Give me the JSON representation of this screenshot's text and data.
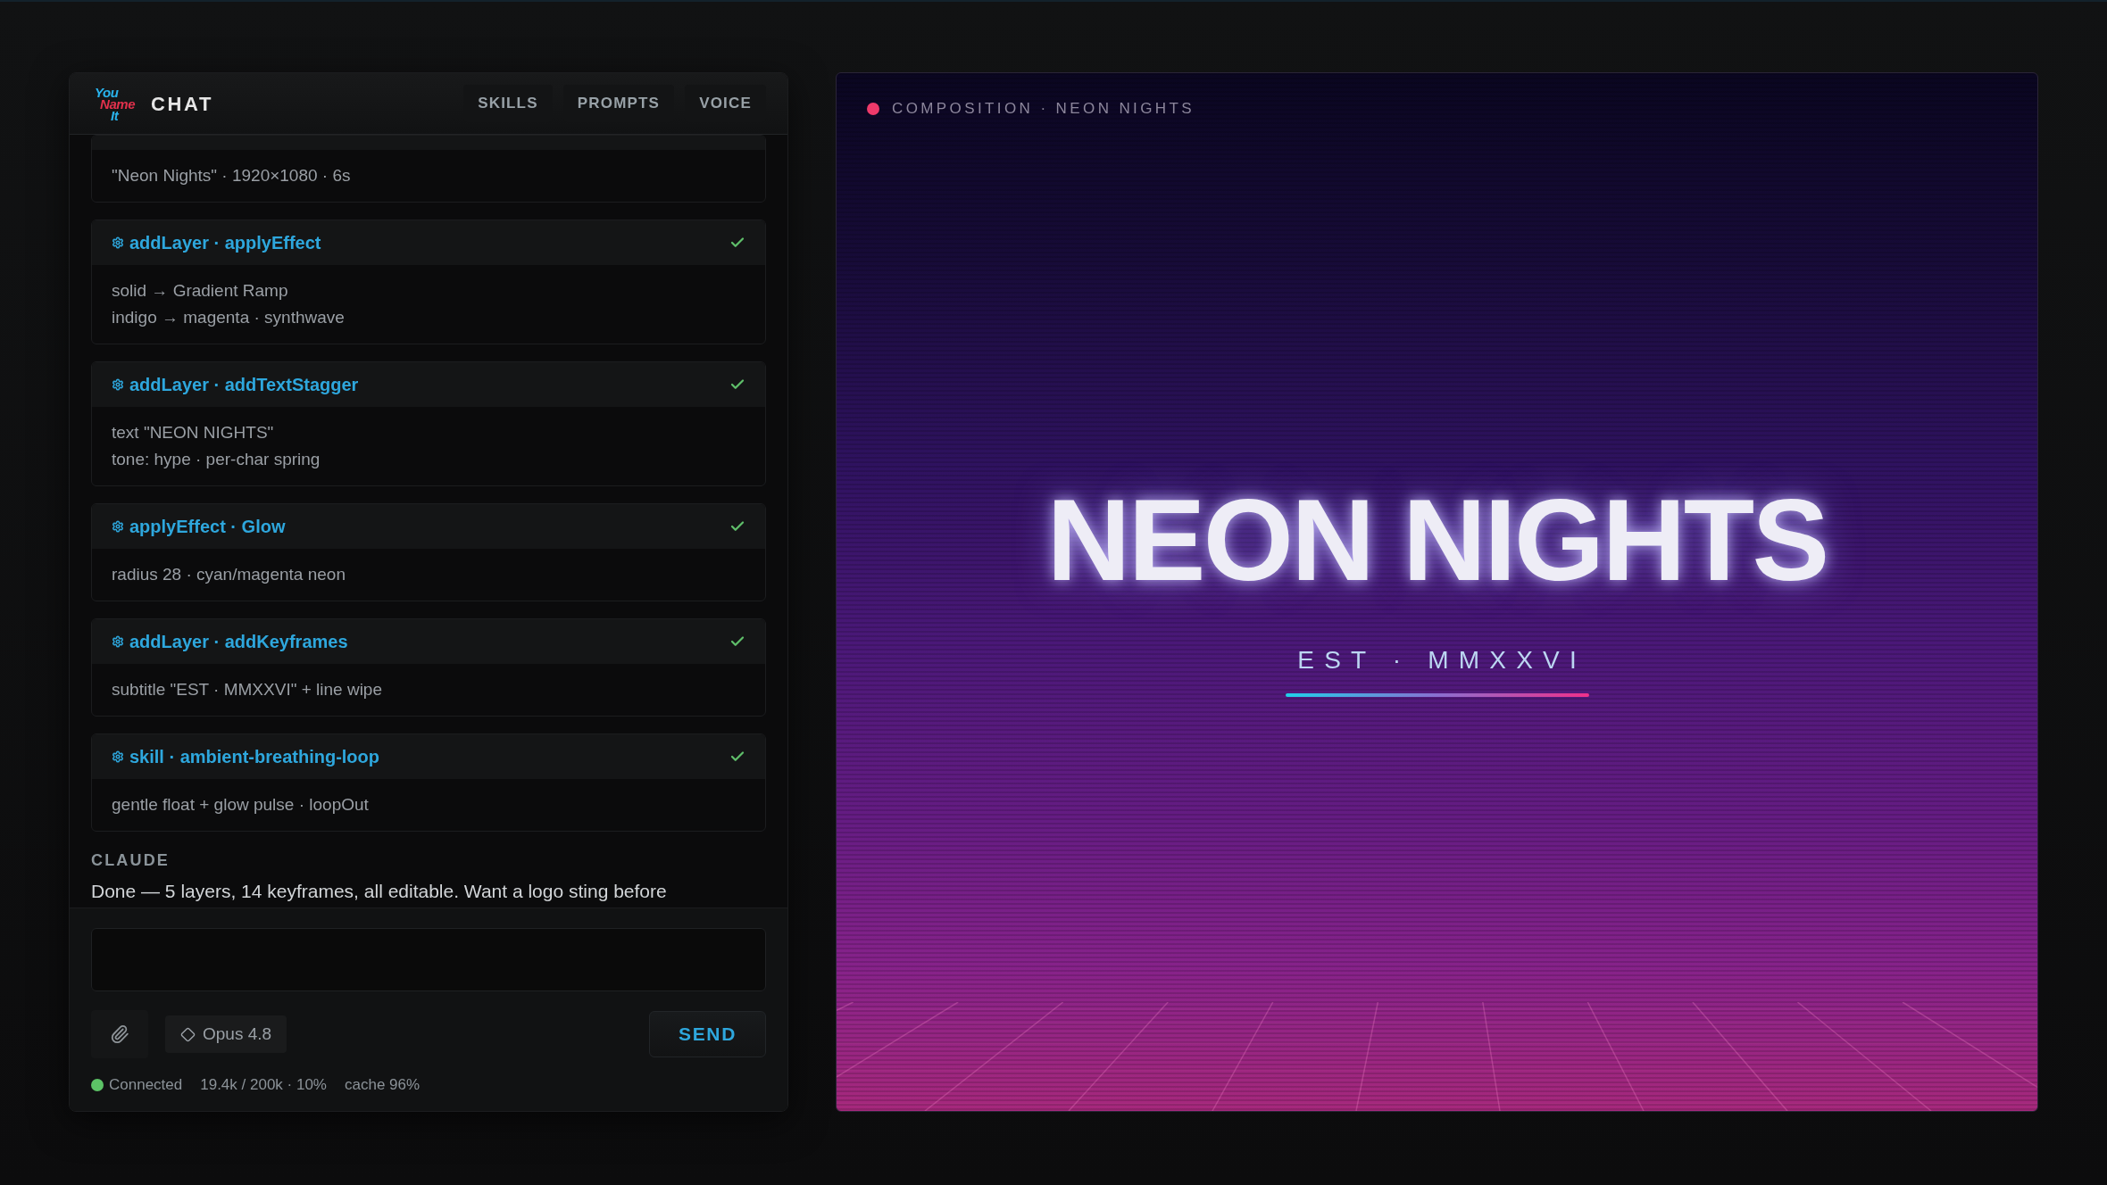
{
  "chat_panel": {
    "logo_text": [
      "You",
      "Name",
      "It"
    ],
    "title": "CHAT",
    "tabs": [
      {
        "label": "SKILLS",
        "selected": false
      },
      {
        "label": "PROMPTS",
        "selected": false
      },
      {
        "label": "VOICE",
        "selected": false
      }
    ],
    "tool_cards": [
      {
        "kind": "cut_off",
        "lines": [
          "\"Neon Nights\" · 1920×1080 · 6s"
        ]
      },
      {
        "kind": "call",
        "title": "addLayer · applyEffect",
        "done": true,
        "lines": [
          "solid → Gradient Ramp",
          "indigo → magenta · synthwave"
        ]
      },
      {
        "kind": "call",
        "title": "addLayer · addTextStagger",
        "done": true,
        "lines": [
          "text \"NEON NIGHTS\"",
          "tone: hype · per-char spring"
        ]
      },
      {
        "kind": "call",
        "title": "applyEffect · Glow",
        "done": true,
        "lines": [
          "radius 28 · cyan/magenta neon"
        ]
      },
      {
        "kind": "call",
        "title": "addLayer · addKeyframes",
        "done": true,
        "lines": [
          "subtitle \"EST · MMXXVI\" + line wipe"
        ]
      },
      {
        "kind": "call",
        "title": "skill · ambient-breathing-loop",
        "done": true,
        "lines": [
          "gentle float + glow pulse · loopOut"
        ]
      }
    ],
    "assistant_message": {
      "author": "CLAUDE",
      "text": "Done — 5 layers, 14 keyframes, all editable. Want a logo sting before"
    },
    "composer": {
      "model": "Opus 4.8",
      "send_label": "SEND"
    },
    "status_bar": {
      "connected": true,
      "connection": "Connected",
      "tokens": "19.4k / 200k · 10%",
      "cache": "cache 96%"
    }
  },
  "composition_panel": {
    "label": "COMPOSITION · NEON NIGHTS",
    "title": "NEON NIGHTS",
    "subtitle": "EST · MMXXVI"
  }
}
